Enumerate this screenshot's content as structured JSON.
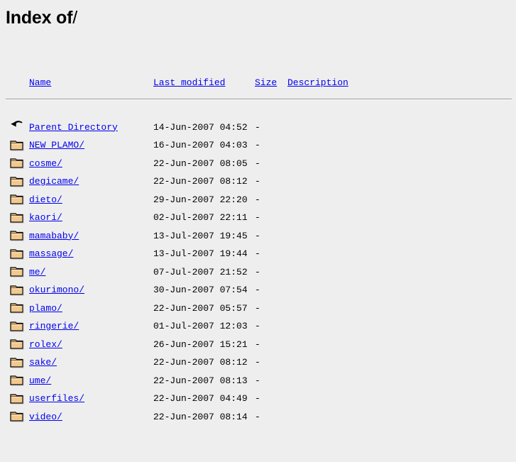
{
  "title": {
    "prefix": "Index of",
    "path": "/"
  },
  "columns": {
    "icon": "",
    "name": "Name",
    "last_modified": "Last modified",
    "size": "Size",
    "description": "Description"
  },
  "colors": {
    "background": "#eeeeee",
    "link": "#0000ee",
    "text": "#000000",
    "rule": "#9a9a9a",
    "folder_body": "#f2c88d",
    "folder_outline": "#000000"
  },
  "entries": [
    {
      "icon": "parent-directory-icon",
      "name": "Parent Directory",
      "last_modified": "14-Jun-2007 04:52",
      "size": "-",
      "description": ""
    },
    {
      "icon": "folder-icon",
      "name": "NEW PLAMO/",
      "last_modified": "16-Jun-2007 04:03",
      "size": "-",
      "description": ""
    },
    {
      "icon": "folder-icon",
      "name": "cosme/",
      "last_modified": "22-Jun-2007 08:05",
      "size": "-",
      "description": ""
    },
    {
      "icon": "folder-icon",
      "name": "degicame/",
      "last_modified": "22-Jun-2007 08:12",
      "size": "-",
      "description": ""
    },
    {
      "icon": "folder-icon",
      "name": "dieto/",
      "last_modified": "29-Jun-2007 22:20",
      "size": "-",
      "description": ""
    },
    {
      "icon": "folder-icon",
      "name": "kaori/",
      "last_modified": "02-Jul-2007 22:11",
      "size": "-",
      "description": ""
    },
    {
      "icon": "folder-icon",
      "name": "mamababy/",
      "last_modified": "13-Jul-2007 19:45",
      "size": "-",
      "description": ""
    },
    {
      "icon": "folder-icon",
      "name": "massage/",
      "last_modified": "13-Jul-2007 19:44",
      "size": "-",
      "description": ""
    },
    {
      "icon": "folder-icon",
      "name": "me/",
      "last_modified": "07-Jul-2007 21:52",
      "size": "-",
      "description": ""
    },
    {
      "icon": "folder-icon",
      "name": "okurimono/",
      "last_modified": "30-Jun-2007 07:54",
      "size": "-",
      "description": ""
    },
    {
      "icon": "folder-icon",
      "name": "plamo/",
      "last_modified": "22-Jun-2007 05:57",
      "size": "-",
      "description": ""
    },
    {
      "icon": "folder-icon",
      "name": "ringerie/",
      "last_modified": "01-Jul-2007 12:03",
      "size": "-",
      "description": ""
    },
    {
      "icon": "folder-icon",
      "name": "rolex/",
      "last_modified": "26-Jun-2007 15:21",
      "size": "-",
      "description": ""
    },
    {
      "icon": "folder-icon",
      "name": "sake/",
      "last_modified": "22-Jun-2007 08:12",
      "size": "-",
      "description": ""
    },
    {
      "icon": "folder-icon",
      "name": "ume/",
      "last_modified": "22-Jun-2007 08:13",
      "size": "-",
      "description": ""
    },
    {
      "icon": "folder-icon",
      "name": "userfiles/",
      "last_modified": "22-Jun-2007 04:49",
      "size": "-",
      "description": ""
    },
    {
      "icon": "folder-icon",
      "name": "video/",
      "last_modified": "22-Jun-2007 08:14",
      "size": "-",
      "description": ""
    }
  ]
}
